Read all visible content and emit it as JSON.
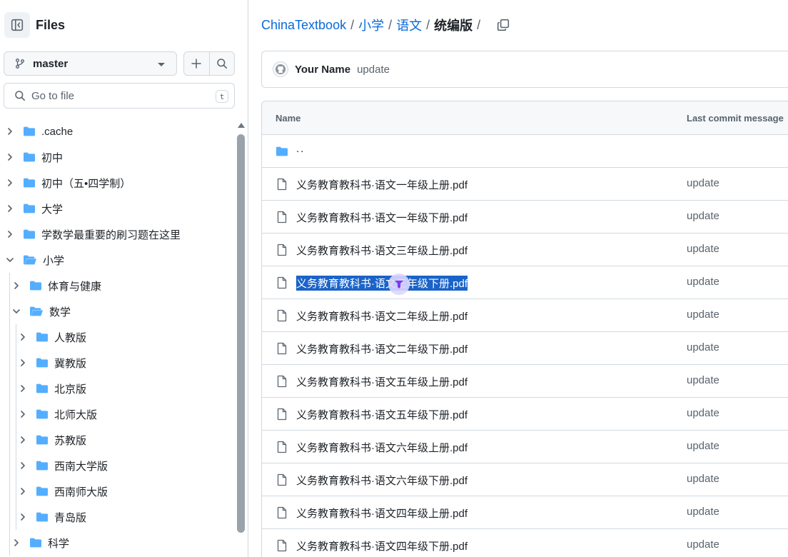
{
  "sidebar": {
    "title": "Files",
    "branch": "master",
    "goto_placeholder": "Go to file",
    "goto_shortcut": "t",
    "tree": [
      {
        "label": ".cache",
        "expanded": false,
        "depth": 0
      },
      {
        "label": "初中",
        "expanded": false,
        "depth": 0
      },
      {
        "label": "初中（五•四学制）",
        "expanded": false,
        "depth": 0
      },
      {
        "label": "大学",
        "expanded": false,
        "depth": 0
      },
      {
        "label": "学数学最重要的刷习题在这里",
        "expanded": false,
        "depth": 0
      },
      {
        "label": "小学",
        "expanded": true,
        "depth": 0
      },
      {
        "label": "体育与健康",
        "expanded": false,
        "depth": 1
      },
      {
        "label": "数学",
        "expanded": true,
        "depth": 1
      },
      {
        "label": "人教版",
        "expanded": false,
        "depth": 2
      },
      {
        "label": "冀教版",
        "expanded": false,
        "depth": 2
      },
      {
        "label": "北京版",
        "expanded": false,
        "depth": 2
      },
      {
        "label": "北师大版",
        "expanded": false,
        "depth": 2
      },
      {
        "label": "苏教版",
        "expanded": false,
        "depth": 2
      },
      {
        "label": "西南大学版",
        "expanded": false,
        "depth": 2
      },
      {
        "label": "西南师大版",
        "expanded": false,
        "depth": 2
      },
      {
        "label": "青岛版",
        "expanded": false,
        "depth": 2
      },
      {
        "label": "科学",
        "expanded": false,
        "depth": 1
      }
    ]
  },
  "breadcrumb": {
    "links": [
      "ChinaTextbook",
      "小学",
      "语文"
    ],
    "current": "统编版",
    "separator": "/"
  },
  "commit": {
    "author": "Your Name",
    "message": "update"
  },
  "table": {
    "col_name": "Name",
    "col_message": "Last commit message",
    "parent_label": "..",
    "files": [
      {
        "name": "义务教育教科书·语文一年级上册.pdf",
        "message": "update",
        "selected": false
      },
      {
        "name": "义务教育教科书·语文一年级下册.pdf",
        "message": "update",
        "selected": false
      },
      {
        "name": "义务教育教科书·语文三年级上册.pdf",
        "message": "update",
        "selected": false
      },
      {
        "name": "义务教育教科书·语文三年级下册.pdf",
        "message": "update",
        "selected": true
      },
      {
        "name": "义务教育教科书·语文二年级上册.pdf",
        "message": "update",
        "selected": false
      },
      {
        "name": "义务教育教科书·语文二年级下册.pdf",
        "message": "update",
        "selected": false
      },
      {
        "name": "义务教育教科书·语文五年级上册.pdf",
        "message": "update",
        "selected": false
      },
      {
        "name": "义务教育教科书·语文五年级下册.pdf",
        "message": "update",
        "selected": false
      },
      {
        "name": "义务教育教科书·语文六年级上册.pdf",
        "message": "update",
        "selected": false
      },
      {
        "name": "义务教育教科书·语文六年级下册.pdf",
        "message": "update",
        "selected": false
      },
      {
        "name": "义务教育教科书·语文四年级上册.pdf",
        "message": "update",
        "selected": false
      },
      {
        "name": "义务教育教科书·语文四年级下册.pdf",
        "message": "update",
        "selected": false
      }
    ]
  },
  "colors": {
    "link": "#0969da",
    "folder": "#54aeff",
    "border": "#d1d9e0",
    "selection": "#1a63c9"
  },
  "icons": [
    "sidebar-collapse-icon",
    "git-branch-icon",
    "plus-icon",
    "search-icon",
    "folder-icon",
    "folder-open-icon",
    "file-icon",
    "copy-icon",
    "github-avatar-icon",
    "chevron-right-icon",
    "chevron-down-icon"
  ]
}
